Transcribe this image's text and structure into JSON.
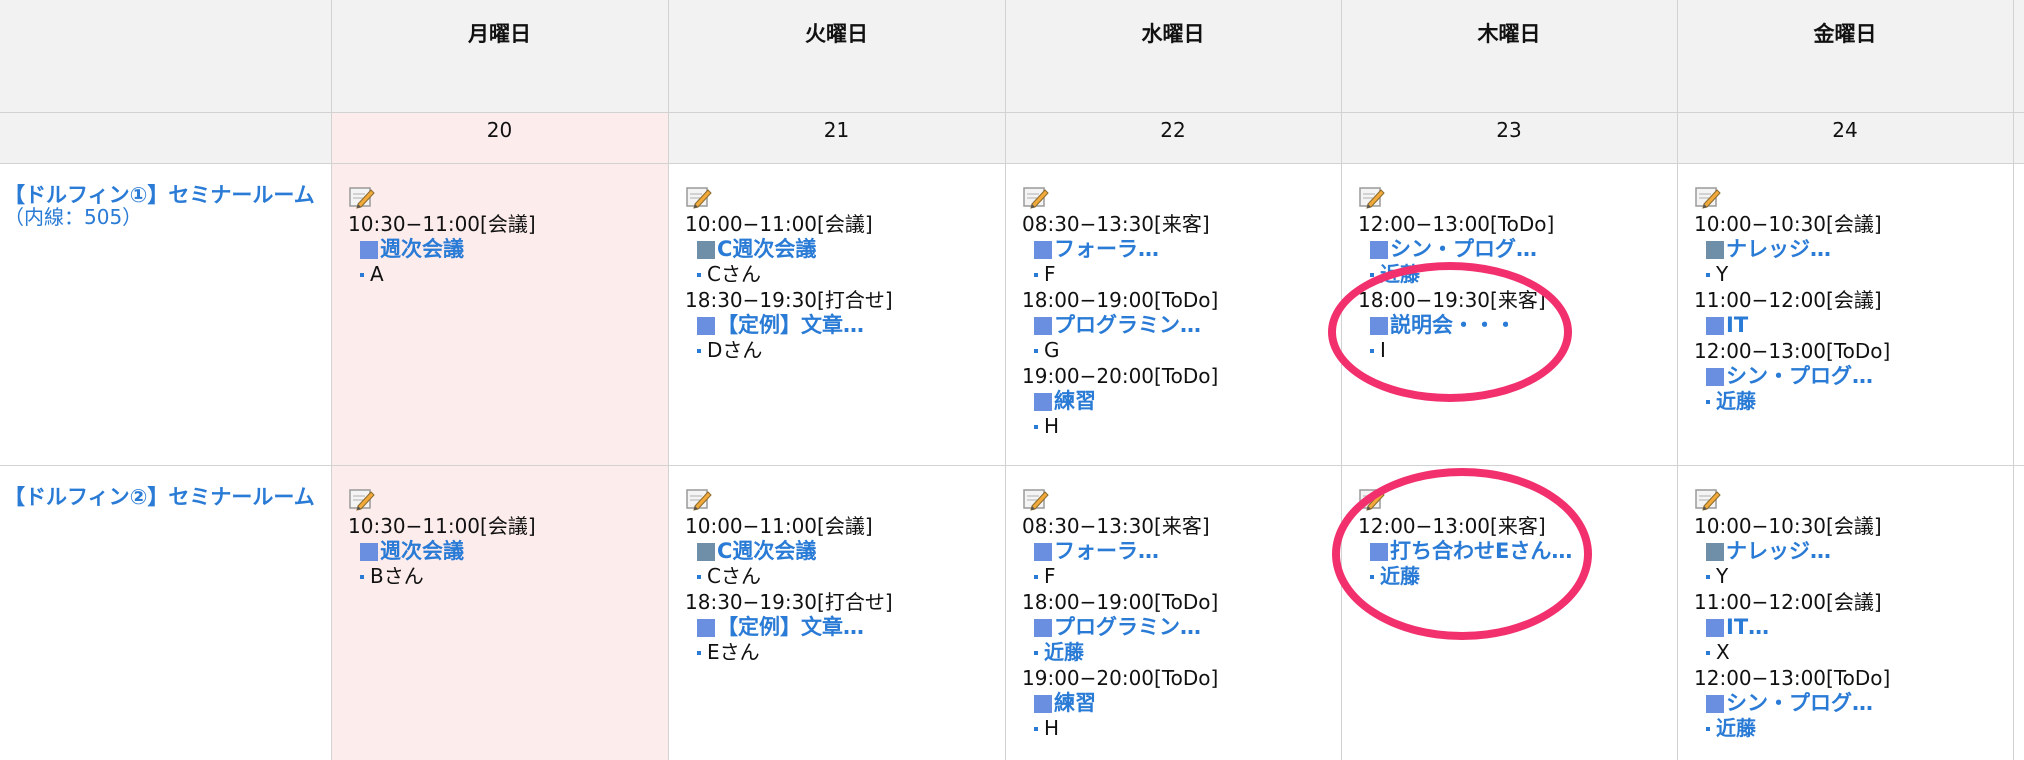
{
  "days": [
    {
      "name": "月曜日",
      "date": "20"
    },
    {
      "name": "火曜日",
      "date": "21"
    },
    {
      "name": "水曜日",
      "date": "22"
    },
    {
      "name": "木曜日",
      "date": "23"
    },
    {
      "name": "金曜日",
      "date": "24"
    }
  ],
  "rooms": [
    {
      "name": "【ドルフィン①】セミナールーム",
      "ext": "（内線：505）"
    },
    {
      "name": "【ドルフィン②】セミナールーム",
      "ext": ""
    }
  ],
  "cells": [
    [
      [
        {
          "time": "10:30−11:00[会議]",
          "title": "週次会議",
          "who": "A",
          "who_link": false,
          "sq": "blue"
        }
      ],
      [
        {
          "time": "10:00−11:00[会議]",
          "title": "C週次会議",
          "who": "Cさん",
          "who_link": false,
          "sq": "gray"
        },
        {
          "time": "18:30−19:30[打合せ]",
          "title": "【定例】文章…",
          "who": "Dさん",
          "who_link": false,
          "sq": "blue"
        }
      ],
      [
        {
          "time": "08:30−13:30[来客]",
          "title": "フォーラ…",
          "who": "F",
          "who_link": false,
          "sq": "blue"
        },
        {
          "time": "18:00−19:00[ToDo]",
          "title": "プログラミン…",
          "who": "G",
          "who_link": false,
          "sq": "blue"
        },
        {
          "time": "19:00−20:00[ToDo]",
          "title": "練習",
          "who": "H",
          "who_link": false,
          "sq": "blue"
        }
      ],
      [
        {
          "time": "12:00−13:00[ToDo]",
          "title": "シン・プログ…",
          "who": "近藤",
          "who_link": true,
          "sq": "blue"
        },
        {
          "time": "18:00−19:30[来客]",
          "title": "説明会・・・",
          "who": "I",
          "who_link": false,
          "sq": "blue"
        }
      ],
      [
        {
          "time": "10:00−10:30[会議]",
          "title": "ナレッジ…",
          "who": "Y",
          "who_link": false,
          "sq": "gray"
        },
        {
          "time": "11:00−12:00[会議]",
          "title": "IT",
          "who": "",
          "who_link": false,
          "sq": "blue"
        },
        {
          "time": "12:00−13:00[ToDo]",
          "title": "シン・プログ…",
          "who": "近藤",
          "who_link": true,
          "sq": "blue"
        }
      ]
    ],
    [
      [
        {
          "time": "10:30−11:00[会議]",
          "title": "週次会議",
          "who": "Bさん",
          "who_link": false,
          "sq": "blue"
        }
      ],
      [
        {
          "time": "10:00−11:00[会議]",
          "title": "C週次会議",
          "who": "Cさん",
          "who_link": false,
          "sq": "gray"
        },
        {
          "time": "18:30−19:30[打合せ]",
          "title": "【定例】文章…",
          "who": "Eさん",
          "who_link": false,
          "sq": "blue"
        }
      ],
      [
        {
          "time": "08:30−13:30[来客]",
          "title": "フォーラ…",
          "who": "F",
          "who_link": false,
          "sq": "blue"
        },
        {
          "time": "18:00−19:00[ToDo]",
          "title": "プログラミン…",
          "who": "近藤",
          "who_link": true,
          "sq": "blue"
        },
        {
          "time": "19:00−20:00[ToDo]",
          "title": "練習",
          "who": "H",
          "who_link": false,
          "sq": "blue"
        }
      ],
      [
        {
          "time": "12:00−13:00[来客]",
          "title": "打ち合わせEさん…",
          "who": "近藤",
          "who_link": true,
          "sq": "blue"
        }
      ],
      [
        {
          "time": "10:00−10:30[会議]",
          "title": "ナレッジ…",
          "who": "Y",
          "who_link": false,
          "sq": "gray"
        },
        {
          "time": "11:00−12:00[会議]",
          "title": "IT…",
          "who": "X",
          "who_link": false,
          "sq": "blue"
        },
        {
          "time": "12:00−13:00[ToDo]",
          "title": "シン・プログ…",
          "who": "近藤",
          "who_link": true,
          "sq": "blue"
        }
      ]
    ]
  ],
  "icons": {
    "memo": "memo-pencil-icon"
  },
  "colors": {
    "link": "#2a7bd6",
    "today": "#fdecec",
    "header": "#f2f2f2",
    "highlight": "#f2306e"
  }
}
